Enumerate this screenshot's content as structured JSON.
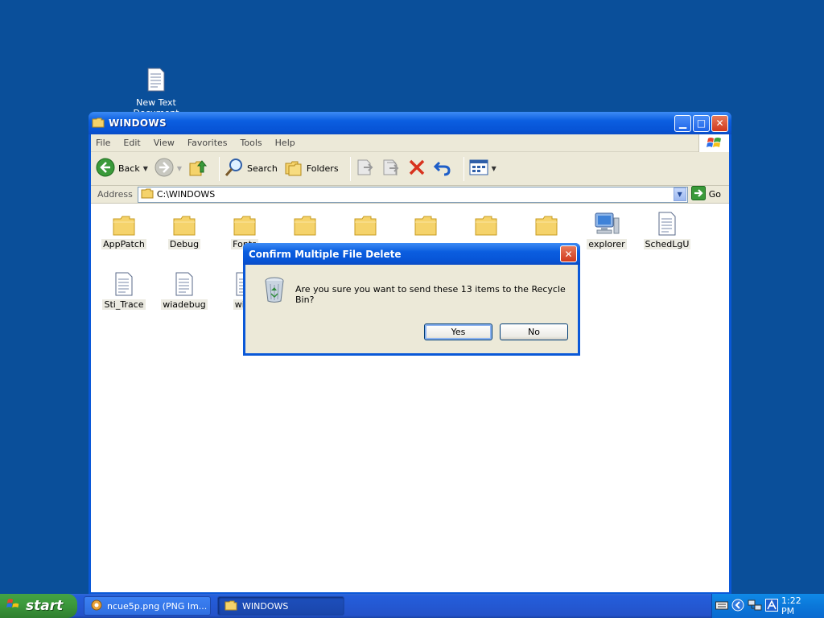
{
  "desktop": {
    "icon_label": "New Text Document"
  },
  "window": {
    "title": "WINDOWS",
    "menu": [
      "File",
      "Edit",
      "View",
      "Favorites",
      "Tools",
      "Help"
    ],
    "toolbar": {
      "back": "Back",
      "search": "Search",
      "folders": "Folders"
    },
    "address": {
      "label": "Address",
      "value": "C:\\WINDOWS",
      "go": "Go"
    },
    "files": [
      {
        "name": "AppPatch",
        "type": "folder"
      },
      {
        "name": "Debug",
        "type": "folder"
      },
      {
        "name": "Fonts",
        "type": "folder"
      },
      {
        "name": "",
        "type": "folder"
      },
      {
        "name": "",
        "type": "folder"
      },
      {
        "name": "",
        "type": "folder"
      },
      {
        "name": "",
        "type": "folder"
      },
      {
        "name": "",
        "type": "folder"
      },
      {
        "name": "explorer",
        "type": "exe"
      },
      {
        "name": "SchedLgU",
        "type": "text"
      },
      {
        "name": "Sti_Trace",
        "type": "text"
      },
      {
        "name": "wiadebug",
        "type": "text"
      },
      {
        "name": "wias",
        "type": "text"
      }
    ]
  },
  "dialog": {
    "title": "Confirm Multiple File Delete",
    "message": "Are you sure you want to send these 13 items to the Recycle Bin?",
    "yes": "Yes",
    "no": "No"
  },
  "taskbar": {
    "start": "start",
    "tasks": [
      "ncue5p.png (PNG Im...",
      "WINDOWS"
    ],
    "clock": "1:22 PM"
  },
  "colors": {
    "desktop": "#0a4f9a",
    "titlebar": "#0b5ee0",
    "taskbar": "#245edb",
    "start": "#3c9a3c"
  }
}
